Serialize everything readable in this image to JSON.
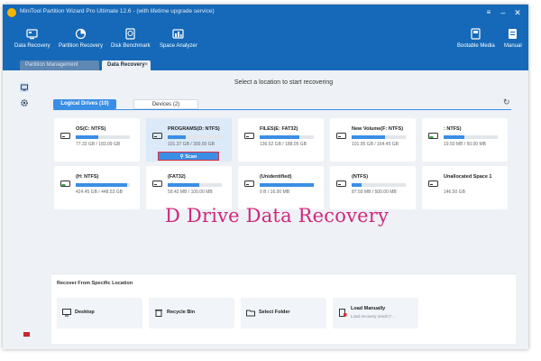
{
  "window": {
    "title": "MiniTool Partition Wizard Pro Ultimate 12.6 - (with lifetime upgrade service)"
  },
  "toolbar": [
    {
      "label": "Data Recovery",
      "icon": "data-recovery-icon"
    },
    {
      "label": "Partition Recovery",
      "icon": "partition-recovery-icon"
    },
    {
      "label": "Disk Benchmark",
      "icon": "disk-benchmark-icon"
    },
    {
      "label": "Space Analyzer",
      "icon": "space-analyzer-icon"
    },
    {
      "label": "Bootable Media",
      "icon": "bootable-media-icon"
    },
    {
      "label": "Manual",
      "icon": "manual-icon"
    }
  ],
  "tabs": {
    "inactive": "Partition Management",
    "active": "Data Recovery",
    "close": "×"
  },
  "main": {
    "heading": "Select a location to start recovering",
    "seg_tabs": {
      "logical": "Logical Drives (10)",
      "devices": "Devices (2)"
    },
    "refresh_icon": "refresh-icon"
  },
  "drives": [
    {
      "name": "OS(C: NTFS)",
      "size": "77.33 GB / 183.09 GB",
      "fill": 0.42
    },
    {
      "name": "PROGRAMS(D: NTFS)",
      "size": "101.37 GB / 300.00 GB",
      "fill": 0.34,
      "highlighted": true,
      "scan_label": "Scan"
    },
    {
      "name": "FILES(E: FAT32)",
      "size": "136.52 GB / 188.05 GB",
      "fill": 0.73
    },
    {
      "name": "New Volume(F: NTFS)",
      "size": "101.95 GB / 164.45 GB",
      "fill": 0.62
    },
    {
      "name": ": NTFS)",
      "size": "19.50 MB / 50.00 MB",
      "fill": 0.39
    },
    {
      "name": "(H: NTFS)",
      "size": "424.45 GB / 448.53 GB",
      "fill": 0.95
    },
    {
      "name": "(FAT32)",
      "size": "59.42 MB / 100.00 MB",
      "fill": 0.59
    },
    {
      "name": "(Unidentified)",
      "size": "0 B / 16.00 MB",
      "fill": 1.0
    },
    {
      "name": "(NTFS)",
      "size": "87.59 MB / 500.00 MB",
      "fill": 0.18
    },
    {
      "name": "Unallocated Space 1",
      "size": "146.50 GB",
      "fill": 0.0
    }
  ],
  "overlay": {
    "title": "D Drive Data Recovery",
    "color": "#d0287c"
  },
  "specific": {
    "title": "Recover From Specific Location",
    "items": [
      {
        "label": "Desktop",
        "icon": "desktop-icon"
      },
      {
        "label": "Recycle Bin",
        "icon": "recycle-bin-icon"
      },
      {
        "label": "Select Folder",
        "icon": "folder-icon"
      },
      {
        "label": "Load Manually",
        "sub": "Load recovery result (*...",
        "icon": "load-file-icon"
      }
    ]
  },
  "colors": {
    "brand": "#1569b8",
    "accent": "#3a8ee6",
    "scan_border": "#e0303a"
  }
}
